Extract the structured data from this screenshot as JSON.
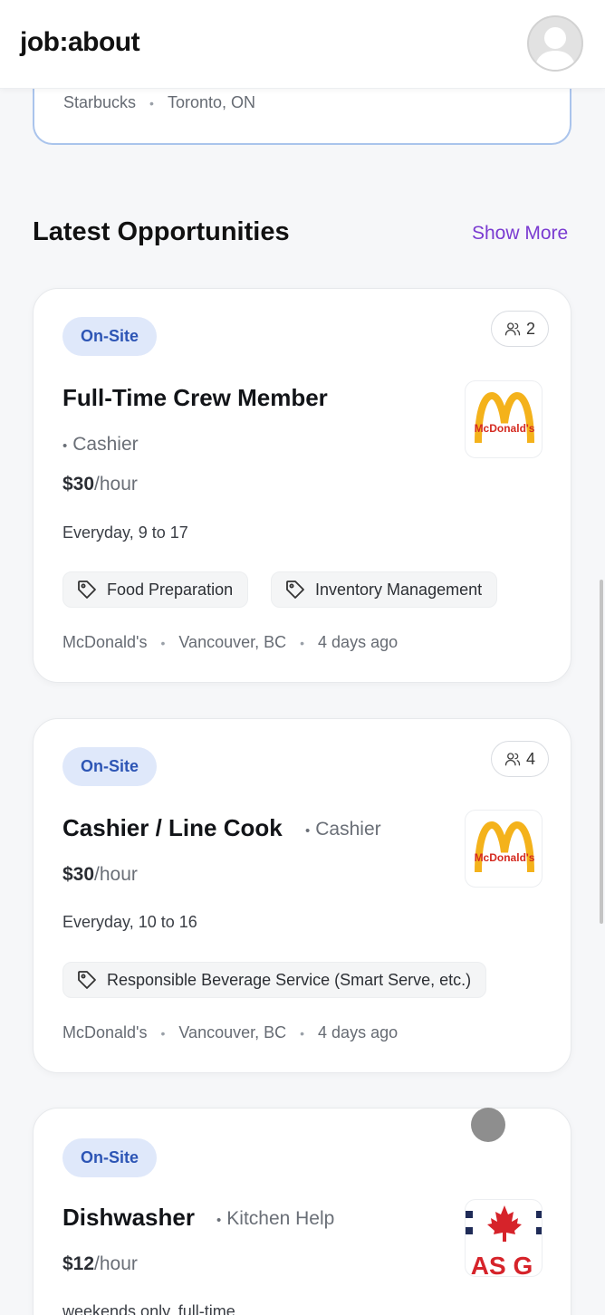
{
  "header": {
    "brand": "job:about"
  },
  "previous_card": {
    "company": "Starbucks",
    "location": "Toronto, ON"
  },
  "section": {
    "title": "Latest Opportunities",
    "show_more": "Show More"
  },
  "colors": {
    "accent": "#7a3bd1",
    "badge_bg": "#dfe8fa",
    "badge_text": "#2d55b5",
    "mcdonalds_gold": "#f4b21b",
    "mcdonalds_red": "#d42a20"
  },
  "jobs": [
    {
      "badge": "On-Site",
      "applicants": "2",
      "title": "Full-Time Crew Member",
      "category": "Cashier",
      "pay_amount": "$30",
      "pay_unit": "/hour",
      "schedule": "Everyday, 9 to 17",
      "tags": [
        "Food Preparation",
        "Inventory Management"
      ],
      "company": "McDonald's",
      "location": "Vancouver, BC",
      "posted": "4 days ago",
      "logo_text": "McDonald's"
    },
    {
      "badge": "On-Site",
      "applicants": "4",
      "title": "Cashier / Line Cook",
      "category": "Cashier",
      "pay_amount": "$30",
      "pay_unit": "/hour",
      "schedule": "Everyday, 10 to 16",
      "tags": [
        "Responsible Beverage Service (Smart Serve, etc.)"
      ],
      "company": "McDonald's",
      "location": "Vancouver, BC",
      "posted": "4 days ago",
      "logo_text": "McDonald's"
    },
    {
      "badge": "On-Site",
      "title": "Dishwasher",
      "category": "Kitchen Help",
      "pay_amount": "$12",
      "pay_unit": "/hour",
      "schedule": "weekends only, full-time",
      "logo_text": "AS G"
    }
  ]
}
